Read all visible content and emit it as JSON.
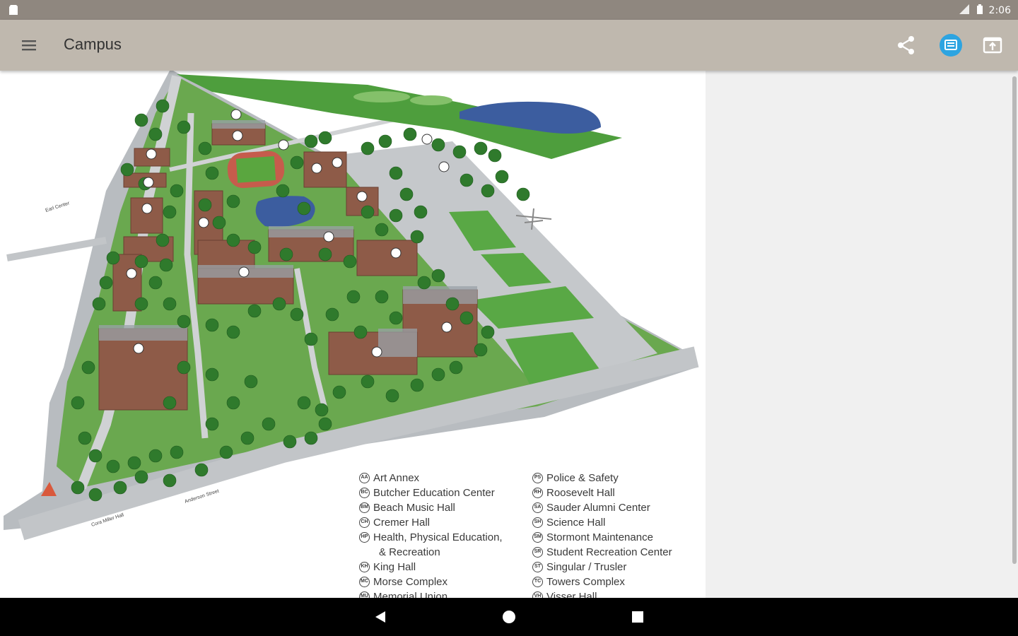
{
  "status_bar": {
    "time": "2:06"
  },
  "app_bar": {
    "title": "Campus",
    "icons": {
      "menu": "hamburger-menu-icon",
      "share": "share-icon",
      "cast": "cast-icon",
      "open": "open-in-window-icon"
    }
  },
  "map": {
    "street_labels": [
      "Earl Center",
      "Anderson Street",
      "Cora Miller Hall"
    ],
    "legend_left": [
      {
        "code": "AA",
        "label": "Art Annex"
      },
      {
        "code": "BC",
        "label": "Butcher Education Center"
      },
      {
        "code": "BM",
        "label": "Beach Music Hall"
      },
      {
        "code": "CH",
        "label": "Cremer Hall"
      },
      {
        "code": "HP",
        "label": "Health, Physical Education,",
        "label2": "& Recreation"
      },
      {
        "code": "KH",
        "label": "King Hall"
      },
      {
        "code": "MC",
        "label": "Morse Complex"
      },
      {
        "code": "MU",
        "label": "Memorial Union"
      }
    ],
    "legend_right": [
      {
        "code": "PS",
        "label": "Police & Safety"
      },
      {
        "code": "RH",
        "label": "Roosevelt Hall"
      },
      {
        "code": "SA",
        "label": "Sauder Alumni Center"
      },
      {
        "code": "SH",
        "label": "Science Hall"
      },
      {
        "code": "SM",
        "label": "Stormont Maintenance"
      },
      {
        "code": "SR",
        "label": "Student Recreation Center"
      },
      {
        "code": "ST",
        "label": "Singular / Trusler"
      },
      {
        "code": "TC",
        "label": "Towers Complex"
      },
      {
        "code": "VH",
        "label": "Visser Hall"
      }
    ]
  },
  "nav_bar": {
    "icons": {
      "back": "back-triangle-icon",
      "home": "home-circle-icon",
      "recents": "recents-square-icon"
    }
  }
}
